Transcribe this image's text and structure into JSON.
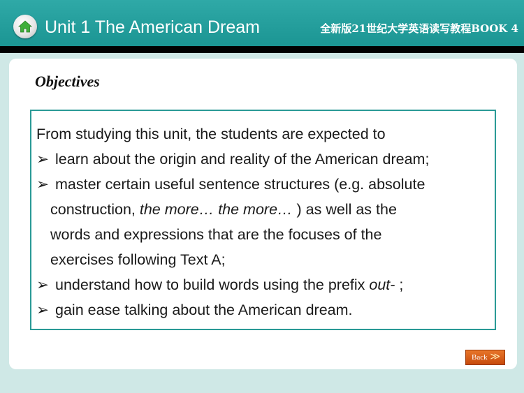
{
  "header": {
    "unit_title": "Unit 1 The American Dream",
    "book_title": "全新版21世纪大学英语读写教程BOOK 4",
    "home_icon": "home-icon"
  },
  "main": {
    "section_title": "Objectives",
    "bullet_glyph": "➢",
    "lines": [
      "From studying this unit, the students are expected to",
      "learn about the origin and reality of the American dream;",
      "master certain useful sentence structures (e.g. absolute",
      "construction, ",
      "the more… the more…",
      " ) as well as the",
      "words and expressions that are the focuses of the",
      "exercises following Text A;",
      "understand how to build words using the prefix ",
      "out-",
      " ;",
      "gain ease talking about the American dream."
    ]
  },
  "footer": {
    "back_label": "Back",
    "back_arrow": "≫"
  },
  "colors": {
    "header": "#1b9593",
    "background": "#cfe8e6",
    "box_border": "#2a9a96",
    "back_button": "#d9601a"
  }
}
